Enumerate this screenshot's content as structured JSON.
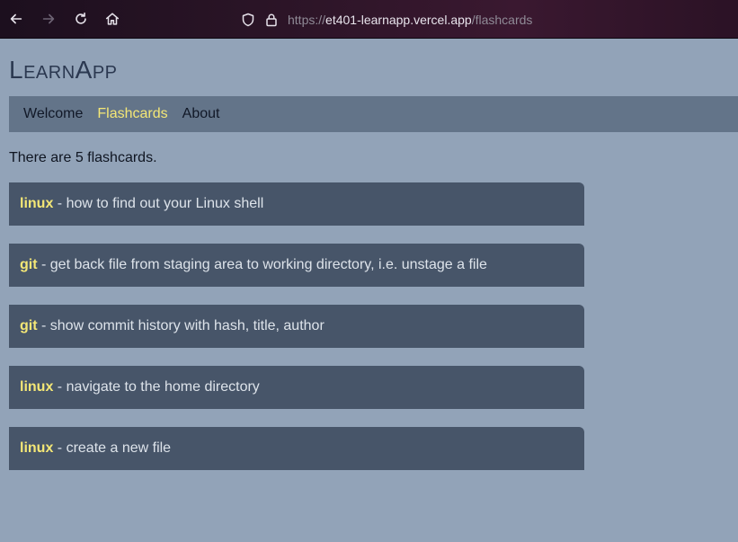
{
  "browser": {
    "url_prefix": "https://",
    "url_host": "et401-learnapp.vercel.app",
    "url_path": "/flashcards"
  },
  "brand": {
    "title": "LearnApp"
  },
  "nav": {
    "items": [
      {
        "label": "Welcome",
        "active": false
      },
      {
        "label": "Flashcards",
        "active": true
      },
      {
        "label": "About",
        "active": false
      }
    ]
  },
  "main": {
    "count_text": "There are 5 flashcards.",
    "flashcards": [
      {
        "topic": "linux",
        "separator": " - ",
        "text": "how to find out your Linux shell"
      },
      {
        "topic": "git",
        "separator": " - ",
        "text": "get back file from staging area to working directory, i.e. unstage a file"
      },
      {
        "topic": "git",
        "separator": " - ",
        "text": "show commit history with hash, title, author"
      },
      {
        "topic": "linux",
        "separator": " - ",
        "text": "navigate to the home directory"
      },
      {
        "topic": "linux",
        "separator": " - ",
        "text": "create a new file"
      }
    ]
  },
  "colors": {
    "page_bg": "#92a3b8",
    "nav_bg": "#637489",
    "card_bg": "#475569",
    "accent": "#f4e776"
  },
  "icons": [
    "back-icon",
    "forward-icon",
    "reload-icon",
    "home-icon",
    "shield-icon",
    "lock-icon"
  ]
}
